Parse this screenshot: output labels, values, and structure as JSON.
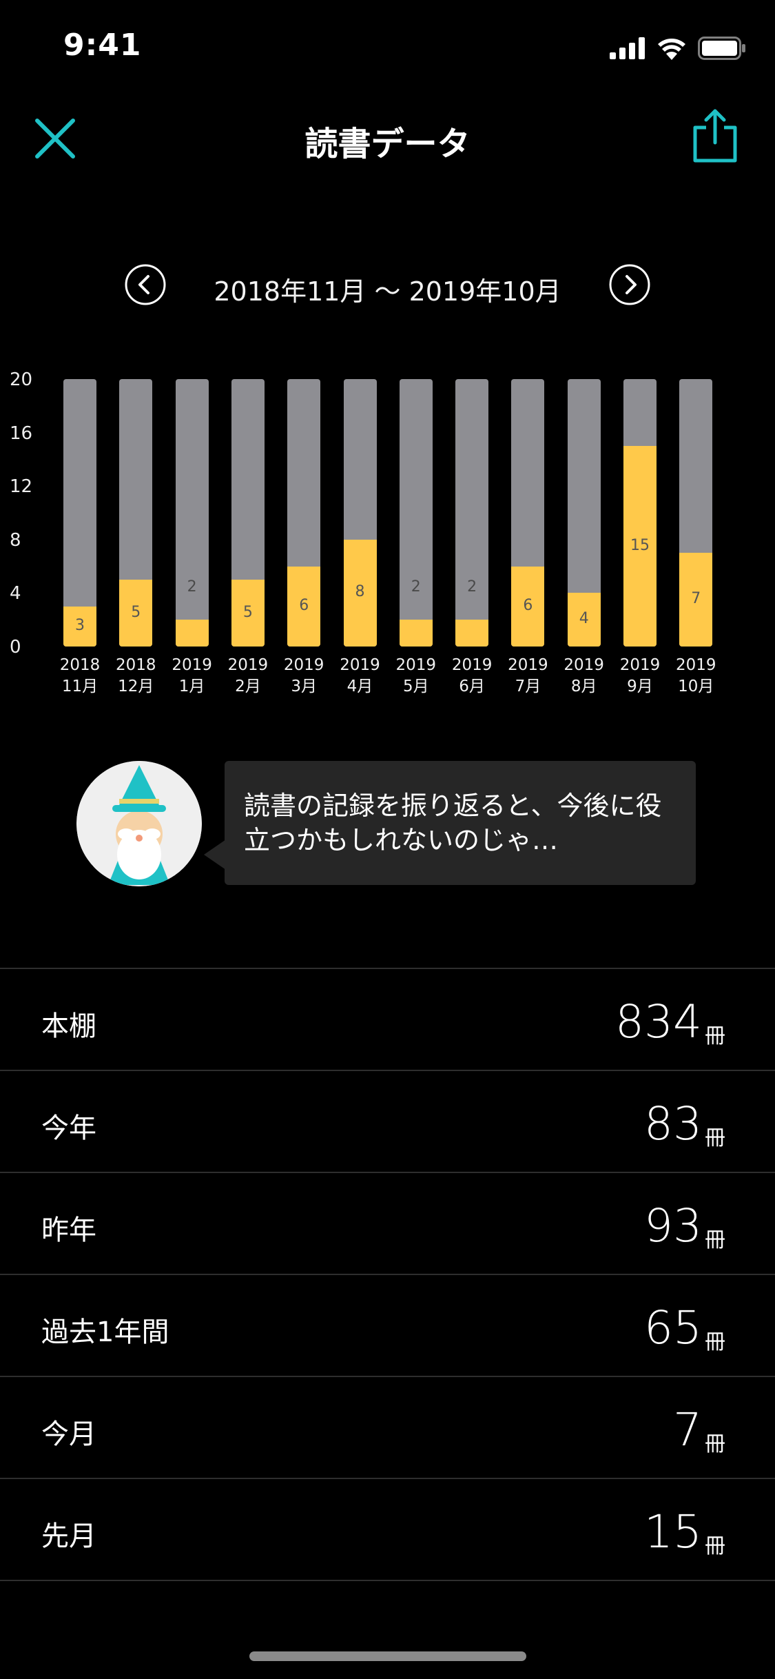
{
  "status_bar": {
    "time": "9:41"
  },
  "nav": {
    "title": "読書データ"
  },
  "period": {
    "label": "2018年11月 〜 2019年10月"
  },
  "chart_data": {
    "type": "bar",
    "y_ticks": [
      "20",
      "16",
      "12",
      "8",
      "4",
      "0"
    ],
    "ylim": [
      0,
      20
    ],
    "categories": [
      [
        "2018",
        "11月"
      ],
      [
        "2018",
        "12月"
      ],
      [
        "2019",
        "1月"
      ],
      [
        "2019",
        "2月"
      ],
      [
        "2019",
        "3月"
      ],
      [
        "2019",
        "4月"
      ],
      [
        "2019",
        "5月"
      ],
      [
        "2019",
        "6月"
      ],
      [
        "2019",
        "7月"
      ],
      [
        "2019",
        "8月"
      ],
      [
        "2019",
        "9月"
      ],
      [
        "2019",
        "10月"
      ]
    ],
    "values": [
      3,
      5,
      2,
      5,
      6,
      8,
      2,
      2,
      6,
      4,
      15,
      7
    ],
    "colors": {
      "fill": "#ffc94a",
      "track": "#8e8e93"
    }
  },
  "wizard": {
    "message": "読書の記録を振り返ると、今後に役立つかもしれないのじゃ…"
  },
  "stats": [
    {
      "label": "本棚",
      "value": "834",
      "unit": "冊"
    },
    {
      "label": "今年",
      "value": "83",
      "unit": "冊"
    },
    {
      "label": "昨年",
      "value": "93",
      "unit": "冊"
    },
    {
      "label": "過去1年間",
      "value": "65",
      "unit": "冊"
    },
    {
      "label": "今月",
      "value": "7",
      "unit": "冊"
    },
    {
      "label": "先月",
      "value": "15",
      "unit": "冊"
    }
  ],
  "colors": {
    "accent": "#1fc1c6",
    "bar_fill": "#ffc94a",
    "bar_track": "#8e8e93"
  }
}
